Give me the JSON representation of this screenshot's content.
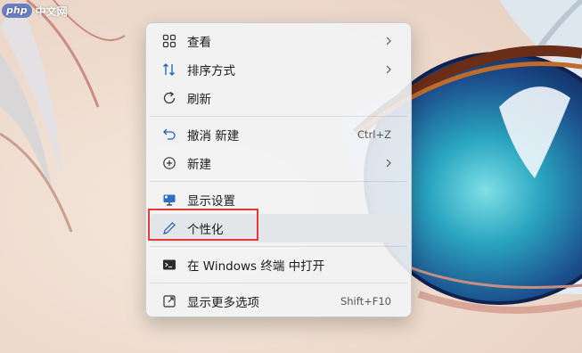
{
  "watermark": {
    "logo": "php",
    "text": "中文网"
  },
  "menu": {
    "items": [
      {
        "label": "查看",
        "icon": "grid-icon",
        "submenu": true
      },
      {
        "label": "排序方式",
        "icon": "sort-icon",
        "submenu": true
      },
      {
        "label": "刷新",
        "icon": "refresh-icon"
      },
      {
        "label": "撤消 新建",
        "icon": "undo-icon",
        "accel": "Ctrl+Z"
      },
      {
        "label": "新建",
        "icon": "add-circle-icon",
        "submenu": true
      },
      {
        "label": "显示设置",
        "icon": "display-icon"
      },
      {
        "label": "个性化",
        "icon": "pen-icon",
        "hovered": true
      },
      {
        "label": "在 Windows 终端 中打开",
        "icon": "terminal-icon"
      },
      {
        "label": "显示更多选项",
        "icon": "more-options-icon",
        "accel": "Shift+F10"
      }
    ]
  },
  "colors": {
    "highlight_box": "#e53935",
    "menu_bg": "#f3f4f6",
    "hover_bg": "#e1e5e7"
  }
}
